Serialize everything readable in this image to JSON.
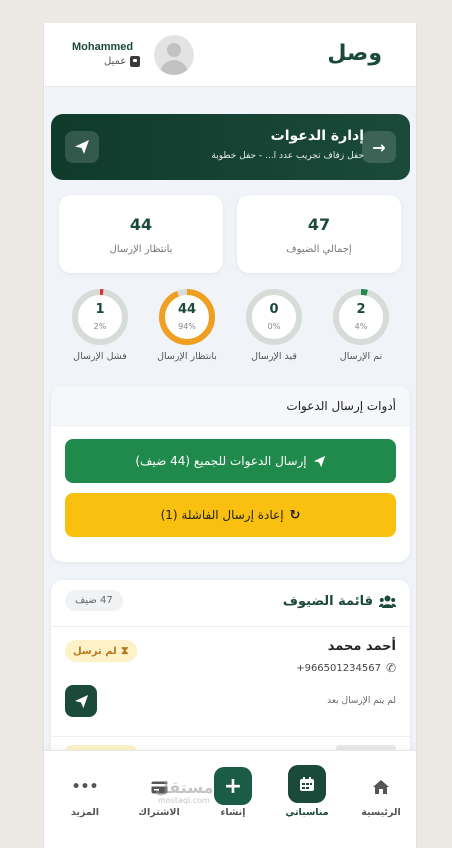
{
  "header": {
    "brand": "وصل",
    "user_name": "Mohammed",
    "user_role": "عميل"
  },
  "banner": {
    "title": "إدارة الدعوات",
    "subtitle": "حفل زفاف تجريب عدد ا... - حفل خطوبة"
  },
  "stats": [
    {
      "value": "47",
      "label": "إجمالي الضيوف"
    },
    {
      "value": "44",
      "label": "بانتظار الإرسال"
    }
  ],
  "progress": [
    {
      "value": "2",
      "percent_label": "4%",
      "label": "تم الإرسال",
      "fraction": 0.04,
      "color": "#1f8a4c"
    },
    {
      "value": "0",
      "percent_label": "0%",
      "label": "قيد الإرسال",
      "fraction": 0.0,
      "color": "#3b82f6"
    },
    {
      "value": "44",
      "percent_label": "94%",
      "label": "بانتظار الإرسال",
      "fraction": 0.94,
      "color": "#f0a020"
    },
    {
      "value": "1",
      "percent_label": "2%",
      "label": "فشل الإرسال",
      "fraction": 0.02,
      "color": "#e03131"
    }
  ],
  "tools": {
    "title": "أدوات إرسال الدعوات",
    "send_all": "إرسال الدعوات للجميع (44 ضيف)",
    "resend_failed": "إعادة إرسال الفاشلة (1)"
  },
  "guests": {
    "title": "قائمة الضيوف",
    "count": "47 ضيف",
    "items": [
      {
        "name": "أحمد محمد",
        "phone": "+966501234567",
        "status": "لم ترسل",
        "note": "لم يتم الإرسال بعد"
      }
    ]
  },
  "nav": {
    "items": [
      {
        "label": "الرئيسية",
        "icon": "home-icon"
      },
      {
        "label": "مناسباتي",
        "icon": "calendar-icon"
      },
      {
        "label": "إنشاء",
        "icon": "plus-icon"
      },
      {
        "label": "الاشتراك",
        "icon": "card-icon"
      },
      {
        "label": "المزيد",
        "icon": "more-icon"
      }
    ]
  },
  "watermark": {
    "text": "مستقل",
    "url": "mostaql.com"
  },
  "colors": {
    "primary_dark": "#1b4a3a",
    "green": "#1f8a4c",
    "yellow": "#fac010"
  }
}
